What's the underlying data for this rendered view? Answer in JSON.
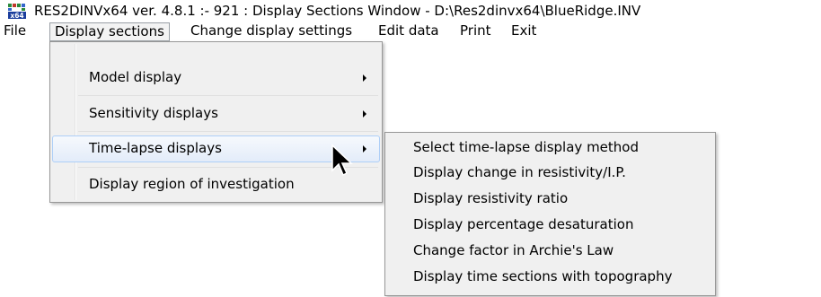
{
  "titlebar": {
    "title": "RES2DINVx64 ver. 4.8.1 :- 921 : Display Sections Window - D:\\Res2dinvx64\\BlueRidge.INV",
    "icon": "app-icon",
    "icon_text": "x64"
  },
  "menubar": {
    "items": [
      {
        "label": "File"
      },
      {
        "label": "Display sections",
        "active": true
      },
      {
        "label": "Change display settings"
      },
      {
        "label": "Edit data"
      },
      {
        "label": "Print"
      },
      {
        "label": "Exit"
      }
    ]
  },
  "dropdown": {
    "items": [
      {
        "label": "Model display",
        "submenu": true
      },
      {
        "label": "Sensitivity displays",
        "submenu": true
      },
      {
        "label": "Time-lapse displays",
        "submenu": true,
        "highlighted": true
      },
      {
        "label": "Display region of investigation",
        "submenu": false
      }
    ]
  },
  "submenu": {
    "items": [
      {
        "label": "Select time-lapse display method"
      },
      {
        "label": "Display change in resistivity/I.P."
      },
      {
        "label": "Display resistivity ratio"
      },
      {
        "label": "Display percentage desaturation"
      },
      {
        "label": "Change factor in Archie's Law"
      },
      {
        "label": "Display time sections with topography"
      }
    ]
  },
  "colors": {
    "menu_bg": "#f0f0f0",
    "highlight_border": "#aecff7",
    "menu_border": "#979797"
  }
}
